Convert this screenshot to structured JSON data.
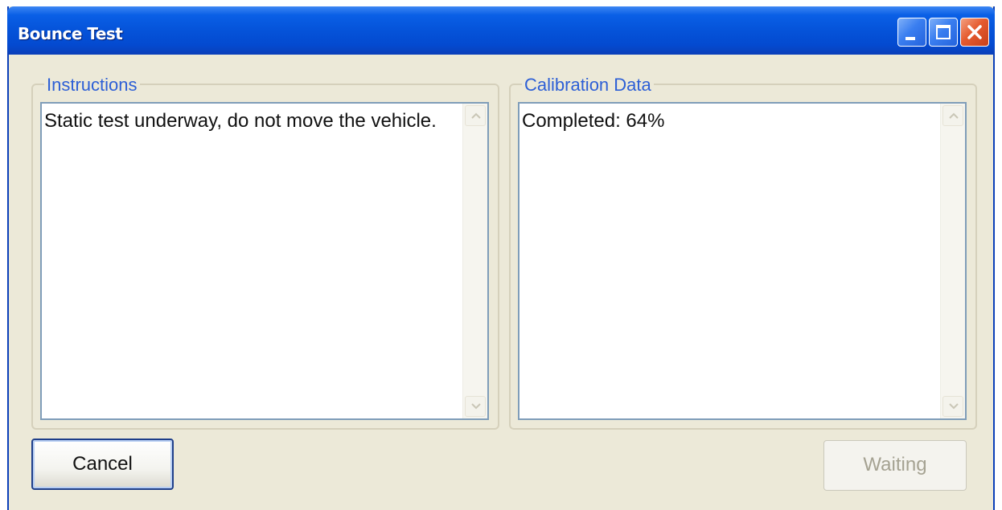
{
  "window": {
    "title": "Bounce Test"
  },
  "instructions": {
    "legend": "Instructions",
    "text": "Static test underway, do not move the vehicle."
  },
  "calibration": {
    "legend": "Calibration Data",
    "text": "Completed: 64%"
  },
  "buttons": {
    "cancel_label": "Cancel",
    "waiting_label": "Waiting",
    "waiting_enabled": false
  },
  "colors": {
    "titlebar": "#0553d9",
    "window_bg": "#ece9d8",
    "legend_text": "#2d5fd6",
    "close_button": "#e55b2f"
  },
  "icons": {
    "minimize": "minimize-icon",
    "maximize": "maximize-icon",
    "close": "close-icon",
    "scroll_up": "chevron-up-icon",
    "scroll_down": "chevron-down-icon"
  }
}
